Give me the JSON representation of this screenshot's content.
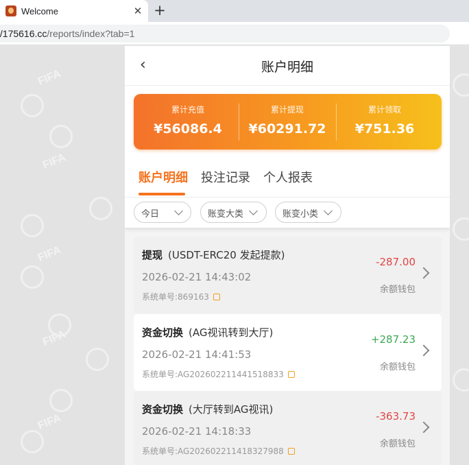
{
  "browser": {
    "tab_title": "Welcome",
    "tab_close": "✕",
    "new_tab": "+",
    "url_host": "//175616.cc",
    "url_rest": "/reports/index?tab=1"
  },
  "background": {
    "watermark": "FIFA"
  },
  "header": {
    "back": "‹",
    "title": "账户明细"
  },
  "summary": {
    "items": [
      {
        "label": "累计充值",
        "value": "¥56086.4"
      },
      {
        "label": "累计提现",
        "value": "¥60291.72"
      },
      {
        "label": "累计领取",
        "value": "¥751.36"
      }
    ]
  },
  "tabs": [
    {
      "label": "账户明细",
      "active": true
    },
    {
      "label": "投注记录",
      "active": false
    },
    {
      "label": "个人报表",
      "active": false
    }
  ],
  "filters": [
    {
      "label": "今日"
    },
    {
      "label": "账变大类"
    },
    {
      "label": "账变小类"
    }
  ],
  "records": [
    {
      "type": "提现",
      "desc": "(USDT-ERC20 发起提款)",
      "date": "2026-02-21 14:43:02",
      "order_label": "系统单号:",
      "order_no": "869163",
      "amount": "-287.00",
      "wallet": "余额钱包"
    },
    {
      "type": "资金切换",
      "desc": "(AG视讯转到大厅)",
      "date": "2026-02-21 14:41:53",
      "order_label": "系统单号:",
      "order_no": "AG202602211441518833",
      "amount": "+287.23",
      "wallet": "余额钱包"
    },
    {
      "type": "资金切换",
      "desc": "(大厅转到AG视讯)",
      "date": "2026-02-21 14:18:33",
      "order_label": "系统单号:",
      "order_no": "AG202602211418327988",
      "amount": "-363.73",
      "wallet": "余额钱包"
    }
  ],
  "colors": {
    "accent": "#f5731f",
    "negative": "#e24444",
    "positive": "#3aa854"
  }
}
